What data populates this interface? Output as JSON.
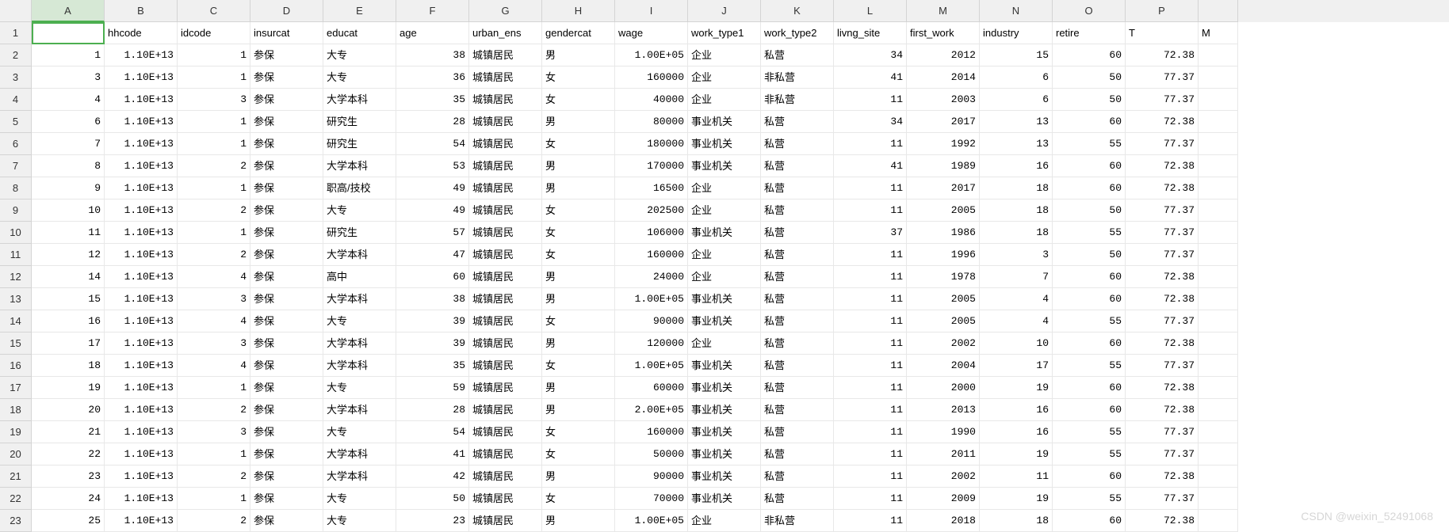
{
  "watermark": "CSDN @weixin_52491068",
  "column_letters": [
    "A",
    "B",
    "C",
    "D",
    "E",
    "F",
    "G",
    "H",
    "I",
    "J",
    "K",
    "L",
    "M",
    "N",
    "O",
    "P"
  ],
  "selected_col": 0,
  "active_cell": {
    "row": 0,
    "col": 0
  },
  "headers": [
    "",
    "hhcode",
    "idcode",
    "insurcat",
    "educat",
    "age",
    "urban_ens",
    "gendercat",
    "wage",
    "work_type1",
    "work_type2",
    "livng_site",
    "first_work",
    "industry",
    "retire",
    "T",
    "M"
  ],
  "col_types": [
    "num",
    "num",
    "num",
    "txt",
    "txt",
    "num",
    "txt",
    "txt",
    "num",
    "txt",
    "txt",
    "num",
    "num",
    "num",
    "num",
    "num",
    "txt"
  ],
  "rows": [
    {
      "n": 1,
      "c": [
        "1",
        "1.10E+13",
        "1",
        "参保",
        "大专",
        "38",
        "城镇居民",
        "男",
        "1.00E+05",
        "企业",
        "私营",
        "34",
        "2012",
        "15",
        "60",
        "72.38",
        ""
      ]
    },
    {
      "n": 3,
      "c": [
        "3",
        "1.10E+13",
        "1",
        "参保",
        "大专",
        "36",
        "城镇居民",
        "女",
        "160000",
        "企业",
        "非私营",
        "41",
        "2014",
        "6",
        "50",
        "77.37",
        ""
      ]
    },
    {
      "n": 4,
      "c": [
        "4",
        "1.10E+13",
        "3",
        "参保",
        "大学本科",
        "35",
        "城镇居民",
        "女",
        "40000",
        "企业",
        "非私营",
        "11",
        "2003",
        "6",
        "50",
        "77.37",
        ""
      ]
    },
    {
      "n": 6,
      "c": [
        "6",
        "1.10E+13",
        "1",
        "参保",
        "研究生",
        "28",
        "城镇居民",
        "男",
        "80000",
        "事业机关",
        "私营",
        "34",
        "2017",
        "13",
        "60",
        "72.38",
        ""
      ]
    },
    {
      "n": 7,
      "c": [
        "7",
        "1.10E+13",
        "1",
        "参保",
        "研究生",
        "54",
        "城镇居民",
        "女",
        "180000",
        "事业机关",
        "私营",
        "11",
        "1992",
        "13",
        "55",
        "77.37",
        ""
      ]
    },
    {
      "n": 8,
      "c": [
        "8",
        "1.10E+13",
        "2",
        "参保",
        "大学本科",
        "53",
        "城镇居民",
        "男",
        "170000",
        "事业机关",
        "私营",
        "41",
        "1989",
        "16",
        "60",
        "72.38",
        ""
      ]
    },
    {
      "n": 9,
      "c": [
        "9",
        "1.10E+13",
        "1",
        "参保",
        "职高/技校",
        "49",
        "城镇居民",
        "男",
        "16500",
        "企业",
        "私营",
        "11",
        "2017",
        "18",
        "60",
        "72.38",
        ""
      ]
    },
    {
      "n": 10,
      "c": [
        "10",
        "1.10E+13",
        "2",
        "参保",
        "大专",
        "49",
        "城镇居民",
        "女",
        "202500",
        "企业",
        "私营",
        "11",
        "2005",
        "18",
        "50",
        "77.37",
        ""
      ]
    },
    {
      "n": 11,
      "c": [
        "11",
        "1.10E+13",
        "1",
        "参保",
        "研究生",
        "57",
        "城镇居民",
        "女",
        "106000",
        "事业机关",
        "私营",
        "37",
        "1986",
        "18",
        "55",
        "77.37",
        ""
      ]
    },
    {
      "n": 12,
      "c": [
        "12",
        "1.10E+13",
        "2",
        "参保",
        "大学本科",
        "47",
        "城镇居民",
        "女",
        "160000",
        "企业",
        "私营",
        "11",
        "1996",
        "3",
        "50",
        "77.37",
        ""
      ]
    },
    {
      "n": 14,
      "c": [
        "14",
        "1.10E+13",
        "4",
        "参保",
        "高中",
        "60",
        "城镇居民",
        "男",
        "24000",
        "企业",
        "私营",
        "11",
        "1978",
        "7",
        "60",
        "72.38",
        ""
      ]
    },
    {
      "n": 15,
      "c": [
        "15",
        "1.10E+13",
        "3",
        "参保",
        "大学本科",
        "38",
        "城镇居民",
        "男",
        "1.00E+05",
        "事业机关",
        "私营",
        "11",
        "2005",
        "4",
        "60",
        "72.38",
        ""
      ]
    },
    {
      "n": 16,
      "c": [
        "16",
        "1.10E+13",
        "4",
        "参保",
        "大专",
        "39",
        "城镇居民",
        "女",
        "90000",
        "事业机关",
        "私营",
        "11",
        "2005",
        "4",
        "55",
        "77.37",
        ""
      ]
    },
    {
      "n": 17,
      "c": [
        "17",
        "1.10E+13",
        "3",
        "参保",
        "大学本科",
        "39",
        "城镇居民",
        "男",
        "120000",
        "企业",
        "私营",
        "11",
        "2002",
        "10",
        "60",
        "72.38",
        ""
      ]
    },
    {
      "n": 18,
      "c": [
        "18",
        "1.10E+13",
        "4",
        "参保",
        "大学本科",
        "35",
        "城镇居民",
        "女",
        "1.00E+05",
        "事业机关",
        "私营",
        "11",
        "2004",
        "17",
        "55",
        "77.37",
        ""
      ]
    },
    {
      "n": 19,
      "c": [
        "19",
        "1.10E+13",
        "1",
        "参保",
        "大专",
        "59",
        "城镇居民",
        "男",
        "60000",
        "事业机关",
        "私营",
        "11",
        "2000",
        "19",
        "60",
        "72.38",
        ""
      ]
    },
    {
      "n": 20,
      "c": [
        "20",
        "1.10E+13",
        "2",
        "参保",
        "大学本科",
        "28",
        "城镇居民",
        "男",
        "2.00E+05",
        "事业机关",
        "私营",
        "11",
        "2013",
        "16",
        "60",
        "72.38",
        ""
      ]
    },
    {
      "n": 21,
      "c": [
        "21",
        "1.10E+13",
        "3",
        "参保",
        "大专",
        "54",
        "城镇居民",
        "女",
        "160000",
        "事业机关",
        "私营",
        "11",
        "1990",
        "16",
        "55",
        "77.37",
        ""
      ]
    },
    {
      "n": 22,
      "c": [
        "22",
        "1.10E+13",
        "1",
        "参保",
        "大学本科",
        "41",
        "城镇居民",
        "女",
        "50000",
        "事业机关",
        "私营",
        "11",
        "2011",
        "19",
        "55",
        "77.37",
        ""
      ]
    },
    {
      "n": 23,
      "c": [
        "23",
        "1.10E+13",
        "2",
        "参保",
        "大学本科",
        "42",
        "城镇居民",
        "男",
        "90000",
        "事业机关",
        "私营",
        "11",
        "2002",
        "11",
        "60",
        "72.38",
        ""
      ]
    },
    {
      "n": 24,
      "c": [
        "24",
        "1.10E+13",
        "1",
        "参保",
        "大专",
        "50",
        "城镇居民",
        "女",
        "70000",
        "事业机关",
        "私营",
        "11",
        "2009",
        "19",
        "55",
        "77.37",
        ""
      ]
    },
    {
      "n": 25,
      "c": [
        "25",
        "1.10E+13",
        "2",
        "参保",
        "大专",
        "23",
        "城镇居民",
        "男",
        "1.00E+05",
        "企业",
        "非私营",
        "11",
        "2018",
        "18",
        "60",
        "72.38",
        ""
      ]
    }
  ]
}
